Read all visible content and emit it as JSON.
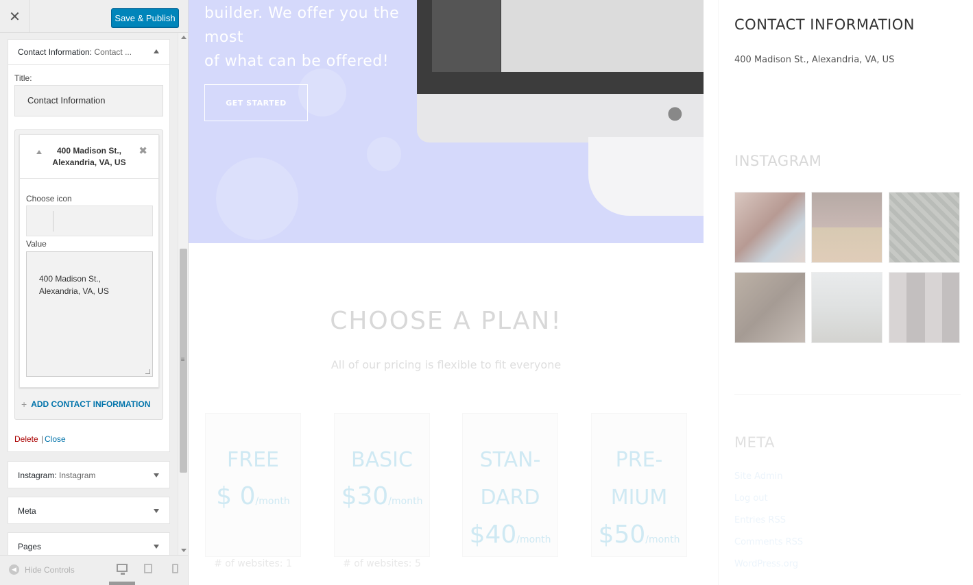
{
  "sidebar": {
    "close_icon": "close-icon",
    "save_label": "Save & Publish",
    "widget": {
      "title": "Contact Information:",
      "subtitle": "Contact ...",
      "title_label": "Title:",
      "title_value": "Contact Information",
      "repeater_item_title": "400 Madison St., Alexandria, VA, US",
      "choose_icon_label": "Choose icon",
      "value_label": "Value",
      "value_text": "400 Madison St.,\nAlexandria, VA, US",
      "add_label": "ADD CONTACT INFORMATION",
      "delete_label": "Delete",
      "separator": "|",
      "close_label": "Close"
    },
    "panels": [
      {
        "title": "Instagram:",
        "subtitle": "Instagram"
      },
      {
        "title": "Meta",
        "subtitle": ""
      },
      {
        "title": "Pages",
        "subtitle": ""
      }
    ],
    "footer": {
      "hide_controls": "Hide Controls"
    }
  },
  "preview": {
    "hero_text": "builder. We offer you the most\nof what can be offered!",
    "get_started": "GET STARTED",
    "plans_title": "CHOOSE A PLAN!",
    "plans_subtitle": "All of our pricing is flexible to fit everyone",
    "plans": [
      {
        "name": "FREE",
        "currency": "$",
        "price": "0",
        "period": "/month",
        "feature": "# of websites: 1"
      },
      {
        "name": "BASIC",
        "currency": "$",
        "price": "30",
        "period": "/month",
        "feature": "# of websites: 5"
      },
      {
        "name": "STAN-\nDARD",
        "currency": "$",
        "price": "40",
        "period": "/month",
        "feature": ""
      },
      {
        "name": "PRE-\nMIUM",
        "currency": "$",
        "price": "50",
        "period": "/month",
        "feature": ""
      }
    ],
    "right": {
      "contact_heading": "CONTACT INFORMATION",
      "contact_address": "400 Madison St., Alexandria, VA, US",
      "instagram_heading": "INSTAGRAM",
      "meta_heading": "META",
      "meta_links": [
        "Site Admin",
        "Log out",
        "Entries RSS",
        "Comments RSS",
        "WordPress.org"
      ]
    }
  },
  "colors": {
    "primary_button": "#0085ba",
    "link": "#0073aa",
    "delete": "#aa0000",
    "hero_bg": "#d5d9fb",
    "plan_accent": "#cfe9f3"
  }
}
